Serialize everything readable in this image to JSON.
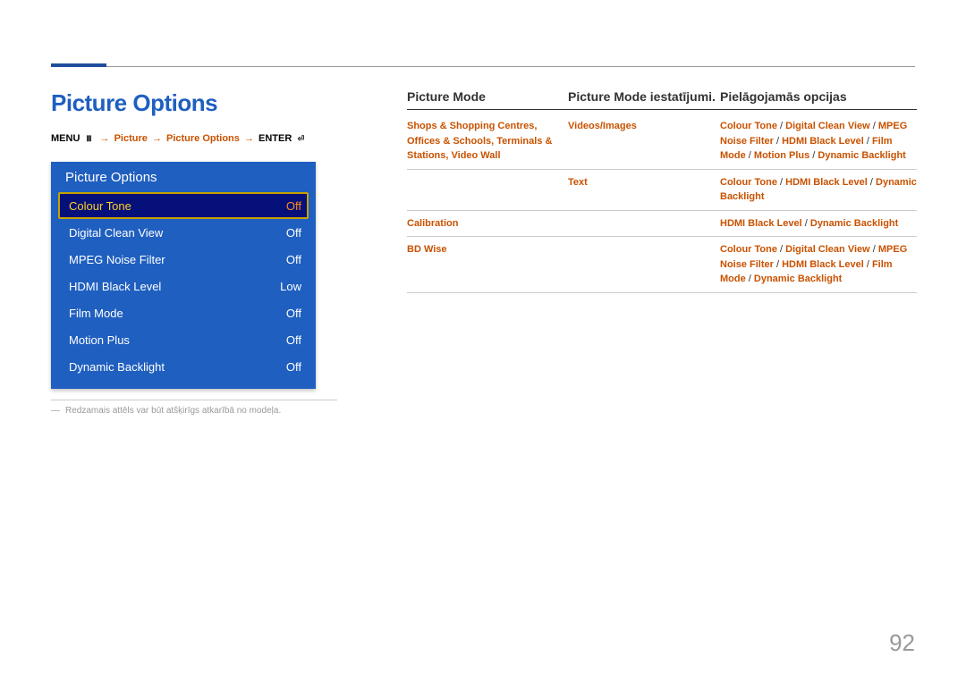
{
  "page": {
    "title": "Picture Options",
    "note": "Redzamais attēls var būt atšķirīgs atkarībā no modeļa.",
    "number": "92"
  },
  "breadcrumb": {
    "menu": "MENU",
    "arrow": "→",
    "picture": "Picture",
    "picture_options": "Picture Options",
    "enter": "ENTER"
  },
  "osd": {
    "title": "Picture Options",
    "items": [
      {
        "label": "Colour Tone",
        "value": "Off",
        "selected": true
      },
      {
        "label": "Digital Clean View",
        "value": "Off",
        "selected": false
      },
      {
        "label": "MPEG Noise Filter",
        "value": "Off",
        "selected": false
      },
      {
        "label": "HDMI Black Level",
        "value": "Low",
        "selected": false
      },
      {
        "label": "Film Mode",
        "value": "Off",
        "selected": false
      },
      {
        "label": "Motion Plus",
        "value": "Off",
        "selected": false
      },
      {
        "label": "Dynamic Backlight",
        "value": "Off",
        "selected": false
      }
    ]
  },
  "table": {
    "head": {
      "c1": "Picture Mode",
      "c2": "Picture Mode iestatījumi.",
      "c3": "Pielāgojamās opcijas"
    },
    "rows": [
      {
        "c1": "Shops & Shopping Centres, Offices & Schools, Terminals & Stations, Video Wall",
        "c2": "Videos/Images",
        "c3_parts": [
          "Colour Tone",
          "Digital Clean View",
          "MPEG Noise Filter",
          "HDMI Black Level",
          "Film Mode",
          "Motion Plus",
          "Dynamic Backlight"
        ]
      },
      {
        "c1": "",
        "c2": "Text",
        "c3_parts": [
          "Colour Tone",
          "HDMI Black Level",
          "Dynamic Backlight"
        ]
      },
      {
        "c1": "Calibration",
        "c2": "",
        "c3_parts": [
          "HDMI Black Level",
          "Dynamic Backlight"
        ]
      },
      {
        "c1": "BD Wise",
        "c2": "",
        "c3_parts": [
          "Colour Tone",
          "Digital Clean View",
          "MPEG Noise Filter",
          "HDMI Black Level",
          "Film Mode",
          "Dynamic Backlight"
        ]
      }
    ]
  },
  "sep": " / "
}
